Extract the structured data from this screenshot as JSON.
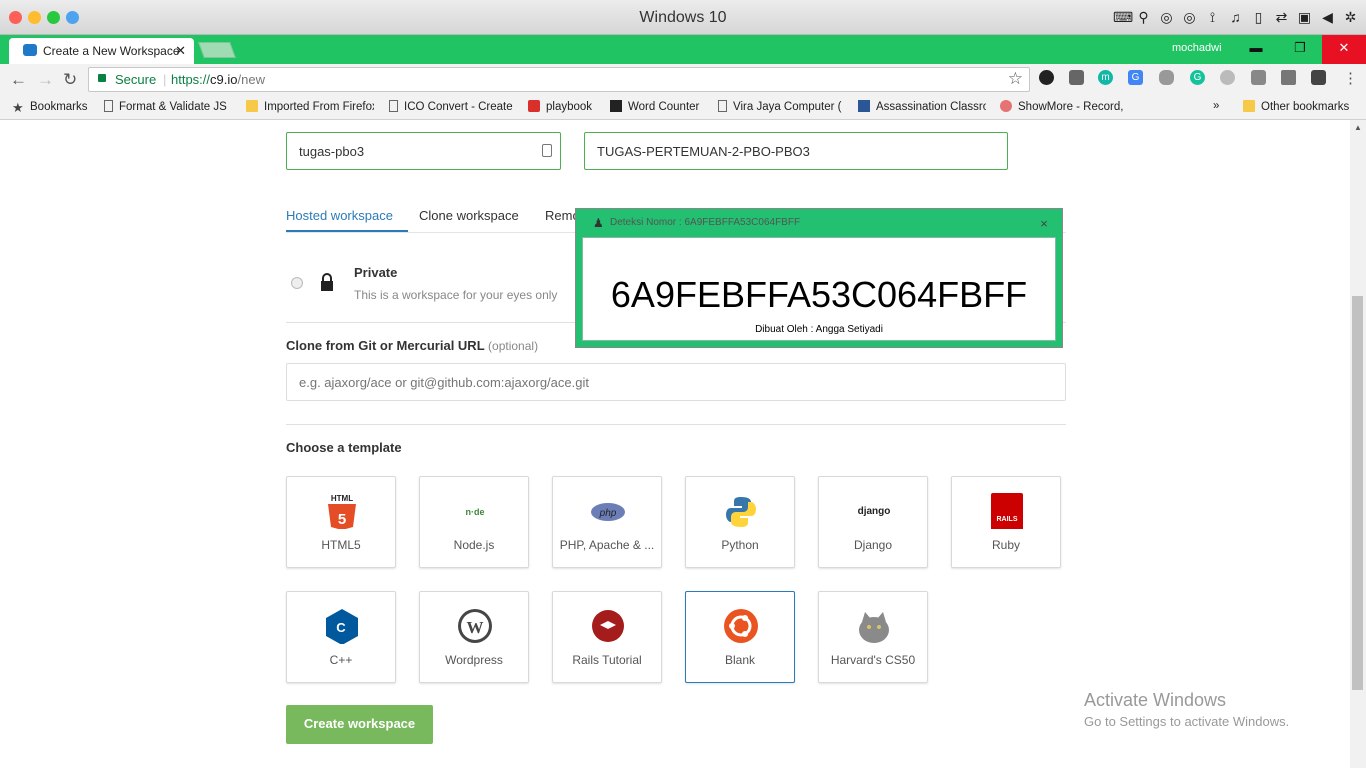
{
  "os": {
    "title": "Windows 10"
  },
  "browser": {
    "tab_title": "Create a New Workspace",
    "profile": "mochadwi",
    "secure_label": "Secure",
    "url_scheme": "https://",
    "url_host": "c9.io",
    "url_path": "/new"
  },
  "bookmarks": {
    "items": [
      "Bookmarks",
      "Format & Validate JS",
      "Imported From Firefox",
      "ICO Convert - Create",
      "playbook",
      "Word Counter",
      "Vira Jaya Computer (",
      "Assassination Classro",
      "ShowMore - Record,"
    ],
    "more": "»",
    "other": "Other bookmarks"
  },
  "form": {
    "workspace_name": "tugas-pbo3",
    "description": "TUGAS-PERTEMUAN-2-PBO-PBO3",
    "tabs": [
      "Hosted workspace",
      "Clone workspace",
      "Remo"
    ],
    "private_title": "Private",
    "private_desc": "This is a workspace for your eyes only",
    "clone_label": "Clone from Git or Mercurial URL",
    "clone_optional": "(optional)",
    "clone_placeholder": "e.g. ajaxorg/ace or git@github.com:ajaxorg/ace.git",
    "template_heading": "Choose a template",
    "templates": [
      "HTML5",
      "Node.js",
      "PHP, Apache & ...",
      "Python",
      "Django",
      "Ruby",
      "C++",
      "Wordpress",
      "Rails Tutorial",
      "Blank",
      "Harvard's CS50"
    ],
    "selected_template": "Blank",
    "create_button": "Create workspace"
  },
  "watermark": {
    "line1": "Activate Windows",
    "line2": "Go to Settings to activate Windows."
  },
  "popup": {
    "title": "Deteksi Nomor : 6A9FEBFFA53C064FBFF",
    "close": "×",
    "code": "6A9FEBFFA53C064FBFF",
    "by": "Dibuat Oleh : Angga Setiyadi"
  },
  "colors": {
    "accent_green": "#21c463",
    "link_blue": "#2b7bb9",
    "button_green": "#78b95d"
  }
}
